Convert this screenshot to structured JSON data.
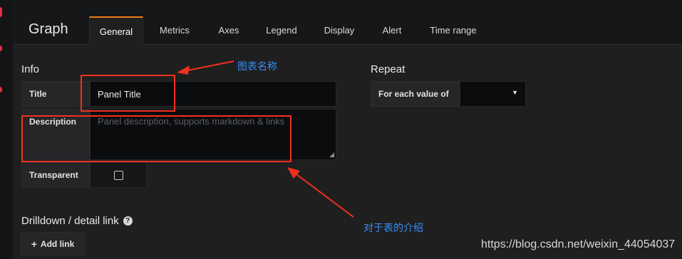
{
  "panel_type": "Graph",
  "tabs": [
    {
      "label": "General",
      "active": true
    },
    {
      "label": "Metrics"
    },
    {
      "label": "Axes"
    },
    {
      "label": "Legend"
    },
    {
      "label": "Display"
    },
    {
      "label": "Alert"
    },
    {
      "label": "Time range"
    }
  ],
  "info": {
    "title": "Info",
    "title_label": "Title",
    "title_value": "Panel Title",
    "description_label": "Description",
    "description_placeholder": "Panel description, supports markdown & links",
    "transparent_label": "Transparent",
    "transparent_checked": false
  },
  "repeat": {
    "title": "Repeat",
    "for_each_label": "For each value of",
    "for_each_value": ""
  },
  "drilldown": {
    "title": "Drilldown / detail link",
    "add_link_label": "Add link"
  },
  "annotations": {
    "title_note": "图表名称",
    "description_note": "对于表的介绍",
    "color": "#f0311e",
    "text_color": "#3a8ef6"
  },
  "watermark": "https://blog.csdn.net/weixin_44054037",
  "colors": {
    "accent_tab": "#eb7b18",
    "background": "#1f1f20",
    "input_bg": "#0b0c0e"
  }
}
